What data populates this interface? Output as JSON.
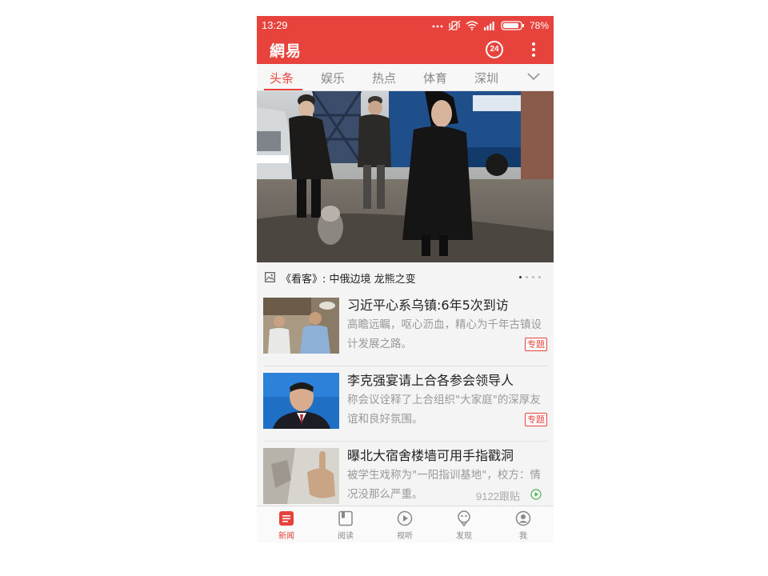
{
  "status_bar": {
    "time": "13:29",
    "battery_percent": "78%",
    "icons": [
      "more-dots-icon",
      "vibrate-off-icon",
      "wifi-icon",
      "signal-icon",
      "battery-icon"
    ]
  },
  "app_bar": {
    "logo": "網易",
    "badge_24": "24",
    "menu_icon": "more-vertical-icon"
  },
  "tabs": [
    {
      "label": "头条",
      "active": true
    },
    {
      "label": "娱乐",
      "active": false
    },
    {
      "label": "热点",
      "active": false
    },
    {
      "label": "体育",
      "active": false
    },
    {
      "label": "深圳",
      "active": false
    }
  ],
  "hero": {
    "caption": "《看客》: 中俄边境 龙熊之变",
    "image_description": "people-walking-construction-site",
    "slide_count": 4,
    "current_slide": 1
  },
  "news": [
    {
      "title": "习近平心系乌镇:6年5次到访",
      "desc": "高瞻远瞩，呕心沥血，精心为千年古镇设计发展之路。",
      "tag": "专题"
    },
    {
      "title": "李克强宴请上合各参会领导人",
      "desc": "称会议诠释了上合组织\"大家庭\"的深厚友谊和良好氛围。",
      "tag": "专题"
    },
    {
      "title": "曝北大宿舍楼墙可用手指戳洞",
      "desc": "被学生戏称为\"一阳指训基地\"，校方：情况没那么严重。",
      "follow": "9122跟贴"
    }
  ],
  "bottom_nav": [
    {
      "label": "新闻",
      "icon": "news-icon",
      "active": true
    },
    {
      "label": "阅读",
      "icon": "read-icon",
      "active": false
    },
    {
      "label": "视听",
      "icon": "play-icon",
      "active": false
    },
    {
      "label": "发现",
      "icon": "discover-icon",
      "active": false
    },
    {
      "label": "我",
      "icon": "profile-icon",
      "active": false
    }
  ],
  "colors": {
    "brand_red": "#e8423c",
    "text_dark": "#222222",
    "text_gray": "#999999"
  }
}
